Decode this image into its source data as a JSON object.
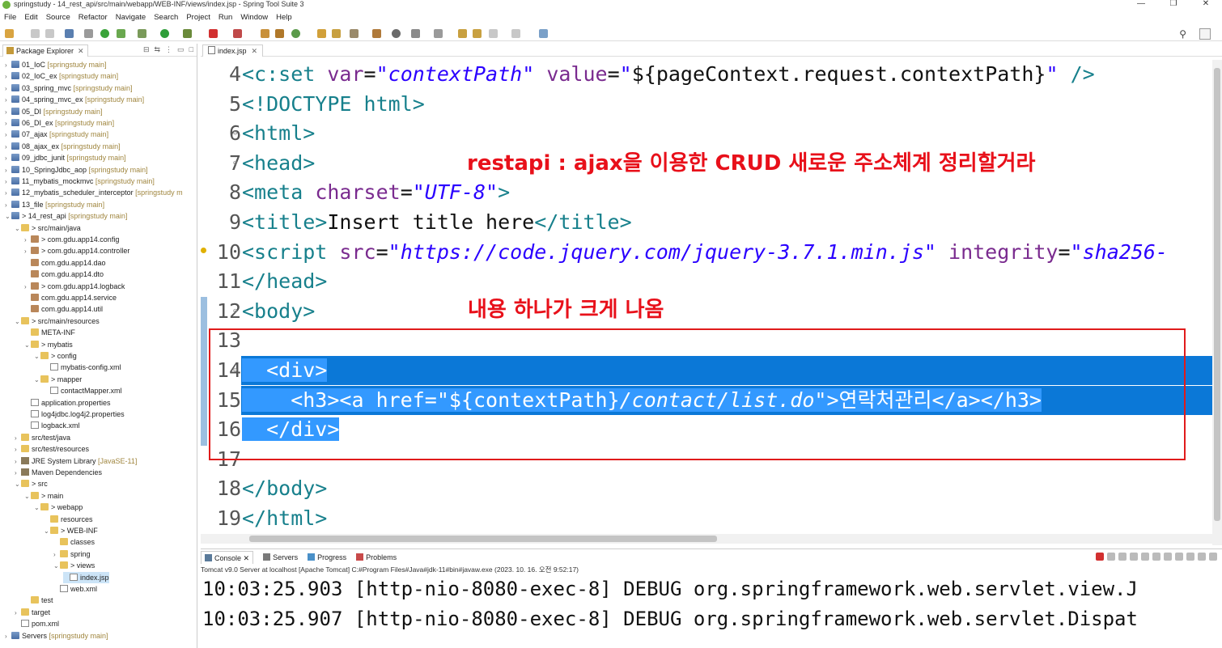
{
  "window": {
    "title": "springstudy - 14_rest_api/src/main/webapp/WEB-INF/views/index.jsp - Spring Tool Suite 3",
    "minimize": "—",
    "maximize": "❐",
    "close": "✕"
  },
  "menu": [
    "File",
    "Edit",
    "Source",
    "Refactor",
    "Navigate",
    "Search",
    "Project",
    "Run",
    "Window",
    "Help"
  ],
  "explorer": {
    "tab_label": "Package Explorer",
    "tree": [
      {
        "label": "01_IoC",
        "dec": "[springstudy main]",
        "indent": 0,
        "icon": "proj",
        "tw": ">"
      },
      {
        "label": "02_IoC_ex",
        "dec": "[springstudy main]",
        "indent": 0,
        "icon": "proj",
        "tw": ">"
      },
      {
        "label": "03_spring_mvc",
        "dec": "[springstudy main]",
        "indent": 0,
        "icon": "proj",
        "tw": ">"
      },
      {
        "label": "04_spring_mvc_ex",
        "dec": "[springstudy main]",
        "indent": 0,
        "icon": "proj",
        "tw": ">"
      },
      {
        "label": "05_DI",
        "dec": "[springstudy main]",
        "indent": 0,
        "icon": "proj",
        "tw": ">"
      },
      {
        "label": "06_DI_ex",
        "dec": "[springstudy main]",
        "indent": 0,
        "icon": "proj",
        "tw": ">"
      },
      {
        "label": "07_ajax",
        "dec": "[springstudy main]",
        "indent": 0,
        "icon": "proj",
        "tw": ">"
      },
      {
        "label": "08_ajax_ex",
        "dec": "[springstudy main]",
        "indent": 0,
        "icon": "proj",
        "tw": ">"
      },
      {
        "label": "09_jdbc_junit",
        "dec": "[springstudy main]",
        "indent": 0,
        "icon": "proj",
        "tw": ">"
      },
      {
        "label": "10_SpringJdbc_aop",
        "dec": "[springstudy main]",
        "indent": 0,
        "icon": "proj",
        "tw": ">"
      },
      {
        "label": "11_mybatis_mockmvc",
        "dec": "[springstudy main]",
        "indent": 0,
        "icon": "proj",
        "tw": ">"
      },
      {
        "label": "12_mybatis_scheduler_interceptor",
        "dec": "[springstudy m",
        "indent": 0,
        "icon": "proj",
        "tw": ">"
      },
      {
        "label": "13_file",
        "dec": "[springstudy main]",
        "indent": 0,
        "icon": "proj",
        "tw": ">"
      },
      {
        "label": "> 14_rest_api",
        "dec": "[springstudy main]",
        "indent": 0,
        "icon": "proj",
        "tw": "v"
      },
      {
        "label": "> src/main/java",
        "dec": "",
        "indent": 1,
        "icon": "folder",
        "tw": "v"
      },
      {
        "label": "> com.gdu.app14.config",
        "dec": "",
        "indent": 2,
        "icon": "pkg",
        "tw": ">"
      },
      {
        "label": "> com.gdu.app14.controller",
        "dec": "",
        "indent": 2,
        "icon": "pkg",
        "tw": ">"
      },
      {
        "label": "com.gdu.app14.dao",
        "dec": "",
        "indent": 2,
        "icon": "pkg",
        "tw": ""
      },
      {
        "label": "com.gdu.app14.dto",
        "dec": "",
        "indent": 2,
        "icon": "pkg",
        "tw": ""
      },
      {
        "label": "> com.gdu.app14.logback",
        "dec": "",
        "indent": 2,
        "icon": "pkg",
        "tw": ">"
      },
      {
        "label": "com.gdu.app14.service",
        "dec": "",
        "indent": 2,
        "icon": "pkg",
        "tw": ""
      },
      {
        "label": "com.gdu.app14.util",
        "dec": "",
        "indent": 2,
        "icon": "pkg",
        "tw": ""
      },
      {
        "label": "> src/main/resources",
        "dec": "",
        "indent": 1,
        "icon": "folder",
        "tw": "v"
      },
      {
        "label": "META-INF",
        "dec": "",
        "indent": 2,
        "icon": "folder",
        "tw": ""
      },
      {
        "label": "> mybatis",
        "dec": "",
        "indent": 2,
        "icon": "folder",
        "tw": "v"
      },
      {
        "label": "> config",
        "dec": "",
        "indent": 3,
        "icon": "folder",
        "tw": "v"
      },
      {
        "label": "mybatis-config.xml",
        "dec": "",
        "indent": 4,
        "icon": "file",
        "tw": ""
      },
      {
        "label": "> mapper",
        "dec": "",
        "indent": 3,
        "icon": "folder",
        "tw": "v"
      },
      {
        "label": "contactMapper.xml",
        "dec": "",
        "indent": 4,
        "icon": "file",
        "tw": ""
      },
      {
        "label": "application.properties",
        "dec": "",
        "indent": 2,
        "icon": "file",
        "tw": ""
      },
      {
        "label": "log4jdbc.log4j2.properties",
        "dec": "",
        "indent": 2,
        "icon": "file",
        "tw": ""
      },
      {
        "label": "logback.xml",
        "dec": "",
        "indent": 2,
        "icon": "file",
        "tw": ""
      },
      {
        "label": "src/test/java",
        "dec": "",
        "indent": 1,
        "icon": "folder",
        "tw": ">"
      },
      {
        "label": "src/test/resources",
        "dec": "",
        "indent": 1,
        "icon": "folder",
        "tw": ">"
      },
      {
        "label": "JRE System Library",
        "dec": "[JavaSE-11]",
        "indent": 1,
        "icon": "lib",
        "tw": ">"
      },
      {
        "label": "Maven Dependencies",
        "dec": "",
        "indent": 1,
        "icon": "lib",
        "tw": ">"
      },
      {
        "label": "> src",
        "dec": "",
        "indent": 1,
        "icon": "folder",
        "tw": "v"
      },
      {
        "label": "> main",
        "dec": "",
        "indent": 2,
        "icon": "folder",
        "tw": "v"
      },
      {
        "label": "> webapp",
        "dec": "",
        "indent": 3,
        "icon": "folder",
        "tw": "v"
      },
      {
        "label": "resources",
        "dec": "",
        "indent": 4,
        "icon": "folder",
        "tw": ""
      },
      {
        "label": "> WEB-INF",
        "dec": "",
        "indent": 4,
        "icon": "folder",
        "tw": "v"
      },
      {
        "label": "classes",
        "dec": "",
        "indent": 5,
        "icon": "folder",
        "tw": ""
      },
      {
        "label": "spring",
        "dec": "",
        "indent": 5,
        "icon": "folder",
        "tw": ">"
      },
      {
        "label": "> views",
        "dec": "",
        "indent": 5,
        "icon": "folder",
        "tw": "v"
      },
      {
        "label": "index.jsp",
        "dec": "",
        "indent": 6,
        "icon": "file",
        "tw": "",
        "selected": true
      },
      {
        "label": "web.xml",
        "dec": "",
        "indent": 5,
        "icon": "file",
        "tw": ""
      },
      {
        "label": "test",
        "dec": "",
        "indent": 2,
        "icon": "folder",
        "tw": ""
      },
      {
        "label": "target",
        "dec": "",
        "indent": 1,
        "icon": "folder",
        "tw": ">"
      },
      {
        "label": "pom.xml",
        "dec": "",
        "indent": 1,
        "icon": "file",
        "tw": ""
      },
      {
        "label": "Servers",
        "dec": "[springstudy main]",
        "indent": 0,
        "icon": "proj",
        "tw": ">"
      }
    ]
  },
  "editor": {
    "tab_label": "index.jsp",
    "lines": [
      {
        "n": "4",
        "html": "<span class='tag'>&lt;c:set</span> <span class='attr'>var</span>=<span class='str'>\"contextPath\"</span> <span class='attr'>value</span>=<span class='str'>\"</span>${pageContext.request.contextPath}<span class='str'>\"</span> <span class='tag'>/&gt;</span>"
      },
      {
        "n": "5",
        "html": "<span class='tag'>&lt;!DOCTYPE html&gt;</span>",
        "fold": ""
      },
      {
        "n": "6",
        "html": "<span class='tag'>&lt;html&gt;</span>",
        "fold": "⊖"
      },
      {
        "n": "7",
        "html": "<span class='tag'>&lt;head&gt;</span>",
        "fold": "⊖"
      },
      {
        "n": "8",
        "html": "<span class='tag'>&lt;meta</span> <span class='attr'>charset</span>=<span class='str'>\"UTF-8\"</span><span class='tag'>&gt;</span>"
      },
      {
        "n": "9",
        "html": "<span class='tag'>&lt;title&gt;</span>Insert title here<span class='tag'>&lt;/title&gt;</span>"
      },
      {
        "n": "10",
        "html": "<span class='tag'>&lt;script</span> <span class='attr'>src</span>=<span class='str'>\"https://code.jquery.com/jquery-3.7.1.min.js\"</span> <span class='attr'>integrity</span>=<span class='str'>\"sha256-</span>",
        "warn": true
      },
      {
        "n": "11",
        "html": "<span class='tag'>&lt;/head&gt;</span>"
      },
      {
        "n": "12",
        "html": "<span class='tag'>&lt;body&gt;</span>",
        "fold": "⊖"
      },
      {
        "n": "13",
        "html": ""
      },
      {
        "n": "14",
        "html": "<span class='hl'>  &lt;div&gt;</span>",
        "fold": "⊖",
        "sel": true
      },
      {
        "n": "15",
        "html": "<span class='hl'>    &lt;h3&gt;&lt;a href=\"${contextPath}<i>/contact/list.do</i>\"&gt;연락처관리&lt;/a&gt;&lt;/h3&gt;</span>",
        "sel": true
      },
      {
        "n": "16",
        "html": "<span class='hl'>  &lt;/div&gt;</span>",
        "selPart": true
      },
      {
        "n": "17",
        "html": ""
      },
      {
        "n": "18",
        "html": "<span class='tag'>&lt;/body&gt;</span>"
      },
      {
        "n": "19",
        "html": "<span class='tag'>&lt;/html&gt;</span>"
      }
    ]
  },
  "annotations": {
    "note1": "restapi : ajax을 이용한 CRUD 새로운 주소체계 정리할거라",
    "note2": "내용 하나가 크게 나옴"
  },
  "console": {
    "tabs": [
      "Console",
      "Servers",
      "Progress",
      "Problems"
    ],
    "server_info": "Tomcat v9.0 Server at localhost [Apache Tomcat] C:#Program Files#Java#jdk-11#bin#javaw.exe  (2023. 10. 16. 오전 9:52:17)",
    "lines": [
      "10:03:25.903 [http-nio-8080-exec-8] DEBUG org.springframework.web.servlet.view.J",
      "10:03:25.907 [http-nio-8080-exec-8] DEBUG org.springframework.web.servlet.Dispat"
    ]
  }
}
